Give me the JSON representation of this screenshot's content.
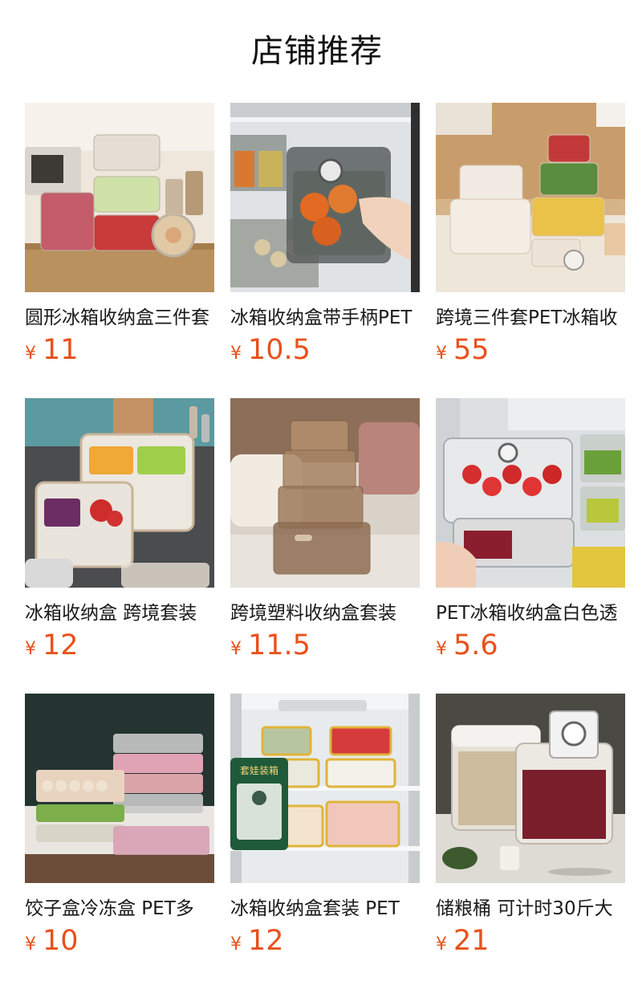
{
  "page": {
    "title": "店铺推荐"
  },
  "colors": {
    "price": "#e8511b",
    "title_text": "#1a1a1a",
    "background": "#ffffff"
  },
  "products": [
    {
      "title": "圆形冰箱收纳盒三件套",
      "currency": "¥",
      "price": "11"
    },
    {
      "title": "冰箱收纳盒带手柄PET",
      "currency": "¥",
      "price": "10.5"
    },
    {
      "title": "跨境三件套PET冰箱收",
      "currency": "¥",
      "price": "55"
    },
    {
      "title": "冰箱收纳盒 跨境套装",
      "currency": "¥",
      "price": "12"
    },
    {
      "title": "跨境塑料收纳盒套装",
      "currency": "¥",
      "price": "11.5"
    },
    {
      "title": "PET冰箱收纳盒白色透",
      "currency": "¥",
      "price": "5.6"
    },
    {
      "title": "饺子盒冷冻盒 PET多",
      "currency": "¥",
      "price": "10"
    },
    {
      "title": "冰箱收纳盒套装 PET",
      "currency": "¥",
      "price": "12"
    },
    {
      "title": "储粮桶 可计时30斤大",
      "currency": "¥",
      "price": "21"
    }
  ],
  "badges": {
    "product_8_label": "套娃装箱"
  }
}
